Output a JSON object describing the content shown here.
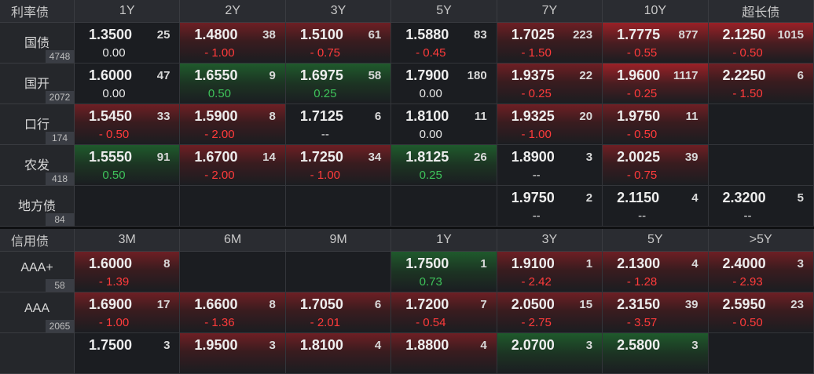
{
  "sections": [
    {
      "title": "利率债",
      "columns": [
        "1Y",
        "2Y",
        "3Y",
        "5Y",
        "7Y",
        "10Y",
        "超长债"
      ],
      "rows": [
        {
          "name": "国债",
          "count": "4748",
          "cells": [
            {
              "rate": "1.3500",
              "vol": "25",
              "chg": "0.00",
              "dir": "flat",
              "bg": "none"
            },
            {
              "rate": "1.4800",
              "vol": "38",
              "chg": "- 1.00",
              "dir": "up",
              "bg": "red"
            },
            {
              "rate": "1.5100",
              "vol": "61",
              "chg": "- 0.75",
              "dir": "up",
              "bg": "red"
            },
            {
              "rate": "1.5880",
              "vol": "83",
              "chg": "- 0.45",
              "dir": "up",
              "bg": "none"
            },
            {
              "rate": "1.7025",
              "vol": "223",
              "chg": "- 1.50",
              "dir": "up",
              "bg": "red"
            },
            {
              "rate": "1.7775",
              "vol": "877",
              "chg": "- 0.55",
              "dir": "up",
              "bg": "redstrong"
            },
            {
              "rate": "2.1250",
              "vol": "1015",
              "chg": "- 0.50",
              "dir": "up",
              "bg": "redstrong"
            }
          ]
        },
        {
          "name": "国开",
          "count": "2072",
          "cells": [
            {
              "rate": "1.6000",
              "vol": "47",
              "chg": "0.00",
              "dir": "flat",
              "bg": "none"
            },
            {
              "rate": "1.6550",
              "vol": "9",
              "chg": "0.50",
              "dir": "down",
              "bg": "green"
            },
            {
              "rate": "1.6975",
              "vol": "58",
              "chg": "0.25",
              "dir": "down",
              "bg": "green"
            },
            {
              "rate": "1.7900",
              "vol": "180",
              "chg": "0.00",
              "dir": "flat",
              "bg": "none"
            },
            {
              "rate": "1.9375",
              "vol": "22",
              "chg": "- 0.25",
              "dir": "up",
              "bg": "red"
            },
            {
              "rate": "1.9600",
              "vol": "1117",
              "chg": "- 0.25",
              "dir": "up",
              "bg": "redstrong"
            },
            {
              "rate": "2.2250",
              "vol": "6",
              "chg": "- 1.50",
              "dir": "up",
              "bg": "red"
            }
          ]
        },
        {
          "name": "口行",
          "count": "174",
          "cells": [
            {
              "rate": "1.5450",
              "vol": "33",
              "chg": "- 0.50",
              "dir": "up",
              "bg": "red"
            },
            {
              "rate": "1.5900",
              "vol": "8",
              "chg": "- 2.00",
              "dir": "up",
              "bg": "red"
            },
            {
              "rate": "1.7125",
              "vol": "6",
              "chg": "--",
              "dir": "flat",
              "bg": "none"
            },
            {
              "rate": "1.8100",
              "vol": "11",
              "chg": "0.00",
              "dir": "flat",
              "bg": "none"
            },
            {
              "rate": "1.9325",
              "vol": "20",
              "chg": "- 1.00",
              "dir": "up",
              "bg": "red"
            },
            {
              "rate": "1.9750",
              "vol": "11",
              "chg": "- 0.50",
              "dir": "up",
              "bg": "red"
            },
            {
              "rate": "",
              "vol": "",
              "chg": "",
              "dir": "flat",
              "bg": "none"
            }
          ]
        },
        {
          "name": "农发",
          "count": "418",
          "cells": [
            {
              "rate": "1.5550",
              "vol": "91",
              "chg": "0.50",
              "dir": "down",
              "bg": "green"
            },
            {
              "rate": "1.6700",
              "vol": "14",
              "chg": "- 2.00",
              "dir": "up",
              "bg": "red"
            },
            {
              "rate": "1.7250",
              "vol": "34",
              "chg": "- 1.00",
              "dir": "up",
              "bg": "red"
            },
            {
              "rate": "1.8125",
              "vol": "26",
              "chg": "0.25",
              "dir": "down",
              "bg": "green"
            },
            {
              "rate": "1.8900",
              "vol": "3",
              "chg": "--",
              "dir": "flat",
              "bg": "none"
            },
            {
              "rate": "2.0025",
              "vol": "39",
              "chg": "- 0.75",
              "dir": "up",
              "bg": "red"
            },
            {
              "rate": "",
              "vol": "",
              "chg": "",
              "dir": "flat",
              "bg": "none"
            }
          ]
        },
        {
          "name": "地方债",
          "count": "84",
          "cells": [
            {
              "rate": "",
              "vol": "",
              "chg": "",
              "dir": "flat",
              "bg": "none"
            },
            {
              "rate": "",
              "vol": "",
              "chg": "",
              "dir": "flat",
              "bg": "none"
            },
            {
              "rate": "",
              "vol": "",
              "chg": "",
              "dir": "flat",
              "bg": "none"
            },
            {
              "rate": "",
              "vol": "",
              "chg": "",
              "dir": "flat",
              "bg": "none"
            },
            {
              "rate": "1.9750",
              "vol": "2",
              "chg": "--",
              "dir": "flat",
              "bg": "none"
            },
            {
              "rate": "2.1150",
              "vol": "4",
              "chg": "--",
              "dir": "flat",
              "bg": "none"
            },
            {
              "rate": "2.3200",
              "vol": "5",
              "chg": "--",
              "dir": "flat",
              "bg": "none"
            }
          ]
        }
      ]
    },
    {
      "title": "信用债",
      "columns": [
        "3M",
        "6M",
        "9M",
        "1Y",
        "3Y",
        "5Y",
        ">5Y"
      ],
      "rows": [
        {
          "name": "AAA+",
          "count": "58",
          "cells": [
            {
              "rate": "1.6000",
              "vol": "8",
              "chg": "- 1.39",
              "dir": "up",
              "bg": "red"
            },
            {
              "rate": "",
              "vol": "",
              "chg": "",
              "dir": "flat",
              "bg": "none"
            },
            {
              "rate": "",
              "vol": "",
              "chg": "",
              "dir": "flat",
              "bg": "none"
            },
            {
              "rate": "1.7500",
              "vol": "1",
              "chg": "0.73",
              "dir": "down",
              "bg": "green"
            },
            {
              "rate": "1.9100",
              "vol": "1",
              "chg": "- 2.42",
              "dir": "up",
              "bg": "red"
            },
            {
              "rate": "2.1300",
              "vol": "4",
              "chg": "- 1.28",
              "dir": "up",
              "bg": "red"
            },
            {
              "rate": "2.4000",
              "vol": "3",
              "chg": "- 2.93",
              "dir": "up",
              "bg": "red"
            }
          ]
        },
        {
          "name": "AAA",
          "count": "2065",
          "cells": [
            {
              "rate": "1.6900",
              "vol": "17",
              "chg": "- 1.00",
              "dir": "up",
              "bg": "red"
            },
            {
              "rate": "1.6600",
              "vol": "8",
              "chg": "- 1.36",
              "dir": "up",
              "bg": "red"
            },
            {
              "rate": "1.7050",
              "vol": "6",
              "chg": "- 2.01",
              "dir": "up",
              "bg": "red"
            },
            {
              "rate": "1.7200",
              "vol": "7",
              "chg": "- 0.54",
              "dir": "up",
              "bg": "red"
            },
            {
              "rate": "2.0500",
              "vol": "15",
              "chg": "- 2.75",
              "dir": "up",
              "bg": "red"
            },
            {
              "rate": "2.3150",
              "vol": "39",
              "chg": "- 3.57",
              "dir": "up",
              "bg": "red"
            },
            {
              "rate": "2.5950",
              "vol": "23",
              "chg": "- 0.50",
              "dir": "up",
              "bg": "red"
            }
          ]
        },
        {
          "name": "",
          "count": "",
          "cells": [
            {
              "rate": "1.7500",
              "vol": "3",
              "chg": "",
              "dir": "flat",
              "bg": "none"
            },
            {
              "rate": "1.9500",
              "vol": "3",
              "chg": "",
              "dir": "flat",
              "bg": "red"
            },
            {
              "rate": "1.8100",
              "vol": "4",
              "chg": "",
              "dir": "flat",
              "bg": "red"
            },
            {
              "rate": "1.8800",
              "vol": "4",
              "chg": "",
              "dir": "flat",
              "bg": "red"
            },
            {
              "rate": "2.0700",
              "vol": "3",
              "chg": "",
              "dir": "flat",
              "bg": "green"
            },
            {
              "rate": "2.5800",
              "vol": "3",
              "chg": "",
              "dir": "flat",
              "bg": "green"
            },
            {
              "rate": "",
              "vol": "",
              "chg": "",
              "dir": "flat",
              "bg": "none"
            }
          ]
        }
      ]
    }
  ]
}
